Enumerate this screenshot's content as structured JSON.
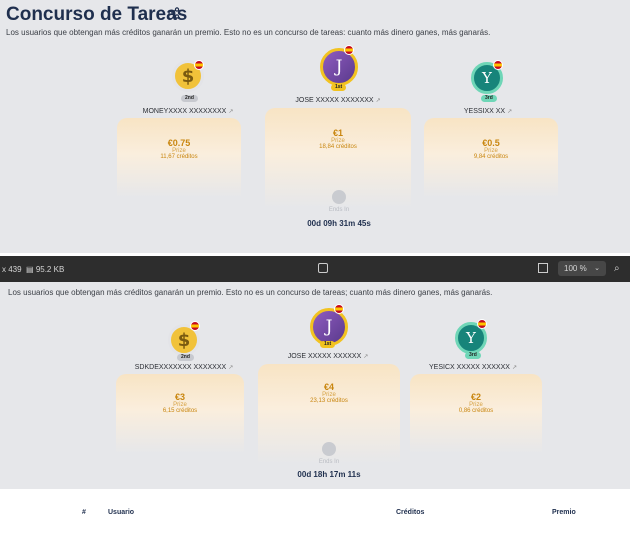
{
  "top": {
    "title": "Concurso de Tareas",
    "share_icon": "share-icon",
    "description": "Los usuarios que obtengan más créditos ganarán un premio. Esto no es un concurso de tareas: cuanto más dinero ganes, más ganarás.",
    "first": {
      "initial": "J",
      "badge": "1st",
      "name": "JOSE XXXXX XXXXXXX",
      "amount": "€1",
      "prize_label": "Prize",
      "credits": "18,84 créditos",
      "color": "#7a4fa8"
    },
    "second": {
      "initial": "$",
      "badge": "2nd",
      "name": "MONEYXXXX XXXXXXXX",
      "amount": "€0.75",
      "prize_label": "Prize",
      "credits": "11,67 créditos",
      "color": "#f1c23a"
    },
    "third": {
      "initial": "Y",
      "badge": "3rd",
      "name": "YESSIXX XX",
      "amount": "€0.5",
      "prize_label": "Prize",
      "credits": "9,84 créditos",
      "color": "#17847a"
    },
    "ends_in": "Ends In",
    "timer": "00d 09h 31m 45s"
  },
  "viewer": {
    "dims": "x 439",
    "file_size": "95.2 KB",
    "zoom": "100 %"
  },
  "bottom": {
    "description": "Los usuarios que obtengan más créditos ganarán un premio. Esto no es un concurso de tareas; cuanto más dinero ganes, más ganarás.",
    "first": {
      "initial": "J",
      "badge": "1st",
      "name": "JOSE XXXXX XXXXXX",
      "amount": "€4",
      "prize_label": "Prize",
      "credits": "23,13 créditos"
    },
    "second": {
      "initial": "$",
      "badge": "2nd",
      "name": "SDKDEXXXXXXX XXXXXXX",
      "amount": "€3",
      "prize_label": "Prize",
      "credits": "6,15 créditos"
    },
    "third": {
      "initial": "Y",
      "badge": "3rd",
      "name": "YESICX XXXXX XXXXXX",
      "amount": "€2",
      "prize_label": "Prize",
      "credits": "0,86 créditos"
    },
    "ends_in": "Ends In",
    "timer": "00d 18h 17m 11s",
    "table_headers": [
      "#",
      "Usuario",
      "Créditos",
      "Premio"
    ]
  },
  "colors": {
    "navy": "#1f2f4e",
    "gold": "#c9860f",
    "first_ring": "#f2c320",
    "third_ring": "#6fd6b7"
  }
}
